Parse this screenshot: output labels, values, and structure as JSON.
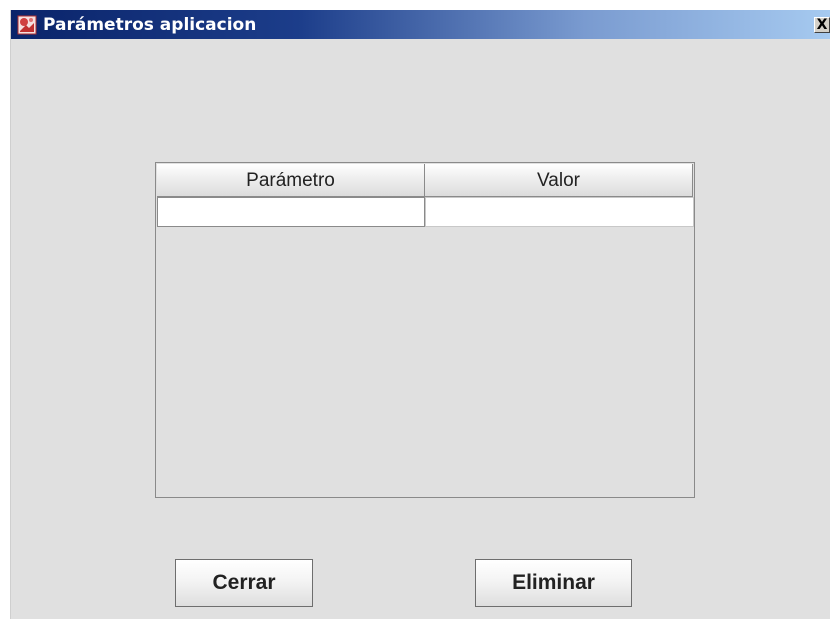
{
  "window": {
    "title": "Parámetros aplicacion",
    "close_label": "X"
  },
  "table": {
    "headers": [
      "Parámetro",
      "Valor"
    ],
    "rows": [
      {
        "parametro": "",
        "valor": ""
      }
    ]
  },
  "buttons": {
    "cerrar": "Cerrar",
    "eliminar": "Eliminar"
  }
}
